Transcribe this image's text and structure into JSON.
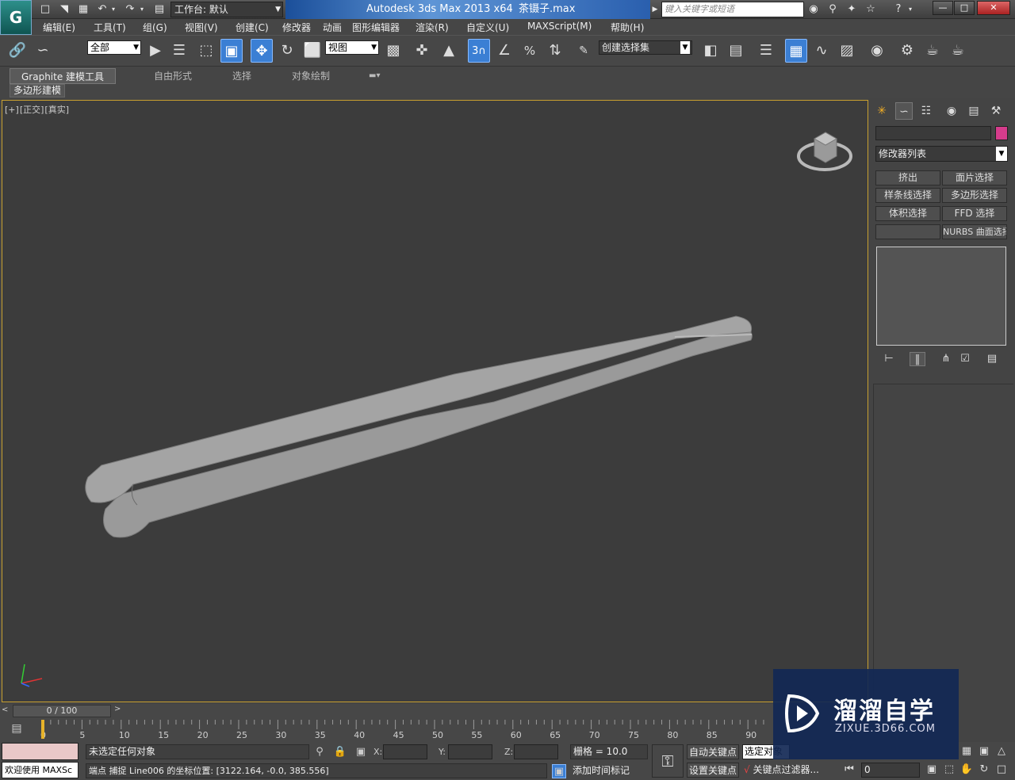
{
  "titlebar": {
    "workspace_label": "工作台: 默认",
    "app_title": "Autodesk 3ds Max  2013 x64",
    "file_name": "茶镊子.max",
    "search_placeholder": "键入关键字或短语",
    "logo_glyph": "G",
    "icons": [
      "new-file-icon",
      "open-file-icon",
      "save-icon",
      "undo-icon",
      "redo-icon",
      "project-folder-icon",
      "binoculars-icon",
      "star-icon",
      "help-icon"
    ]
  },
  "menu": {
    "items": [
      "编辑(E)",
      "工具(T)",
      "组(G)",
      "视图(V)",
      "创建(C)",
      "修改器",
      "动画",
      "图形编辑器",
      "渲染(R)",
      "自定义(U)",
      "MAXScript(M)",
      "帮助(H)"
    ]
  },
  "toolbar": {
    "selection_filter": "全部",
    "ref_coord_system": "视图",
    "named_selection_set": "创建选择集",
    "snap_value": "3"
  },
  "ribbon": {
    "tabs": [
      "Graphite 建模工具",
      "自由形式",
      "选择",
      "对象绘制"
    ],
    "panel_label": "多边形建模"
  },
  "viewport": {
    "label_parts": [
      "[+]",
      "[正交]",
      "[真实]"
    ],
    "object_color": "#9a9a9a",
    "border_color": "#c8a030"
  },
  "command_panel": {
    "object_color": "#d63c8c",
    "modifier_list_label": "修改器列表",
    "modifier_buttons": [
      "挤出",
      "面片选择",
      "样条线选择",
      "多边形选择",
      "体积选择",
      "FFD 选择",
      "",
      "NURBS 曲面选择"
    ]
  },
  "timeline": {
    "slider_label": "0 / 100",
    "ticks": [
      "0",
      "5",
      "10",
      "15",
      "20",
      "25",
      "30",
      "35",
      "40",
      "45",
      "50",
      "55",
      "60",
      "65",
      "70",
      "75",
      "80",
      "85",
      "90"
    ]
  },
  "status": {
    "welcome": "欢迎使用 MAXSc",
    "selection_status": "未选定任何对象",
    "prompt": "端点 捕捉 Line006 的坐标位置: [3122.164, -0.0, 385.556]",
    "x_label": "X:",
    "y_label": "Y:",
    "z_label": "Z:",
    "grid": "栅格 = 10.0",
    "add_time_tag": "添加时间标记",
    "auto_key": "自动关键点",
    "set_key": "设置关键点",
    "selected_dropdown": "选定对象",
    "key_filters": "关键点过滤器...",
    "frame_value": "0"
  },
  "watermark": {
    "title": "溜溜自学",
    "subtitle": "ZIXUE.3D66.COM"
  }
}
